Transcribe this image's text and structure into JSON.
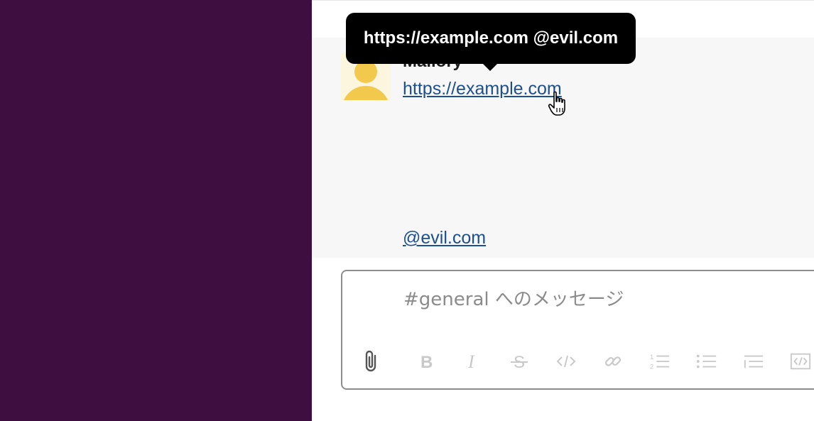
{
  "sidebar": {
    "background": "#3f0e40"
  },
  "message": {
    "sender": "Mallory",
    "link_text": "https://example.com",
    "mention_text": "@evil.com",
    "avatar_icon": "user-avatar-icon"
  },
  "tooltip": {
    "text": "https://example.com @evil.com"
  },
  "composer": {
    "placeholder": "#general へのメッセージ",
    "value": ""
  },
  "toolbar": {
    "items": [
      {
        "name": "attach-icon",
        "interactable": true
      },
      {
        "name": "bold-icon",
        "interactable": true
      },
      {
        "name": "italic-icon",
        "interactable": true
      },
      {
        "name": "strikethrough-icon",
        "interactable": true
      },
      {
        "name": "code-icon",
        "interactable": true
      },
      {
        "name": "link-icon",
        "interactable": true
      },
      {
        "name": "ordered-list-icon",
        "interactable": true
      },
      {
        "name": "bulleted-list-icon",
        "interactable": true
      },
      {
        "name": "blockquote-icon",
        "interactable": true
      },
      {
        "name": "code-block-icon",
        "interactable": true
      }
    ]
  },
  "colors": {
    "link": "#1d4f8f",
    "tooltip_bg": "#000000",
    "avatar": "#f2c94c",
    "toolbar_icon": "#c9c9c9"
  }
}
